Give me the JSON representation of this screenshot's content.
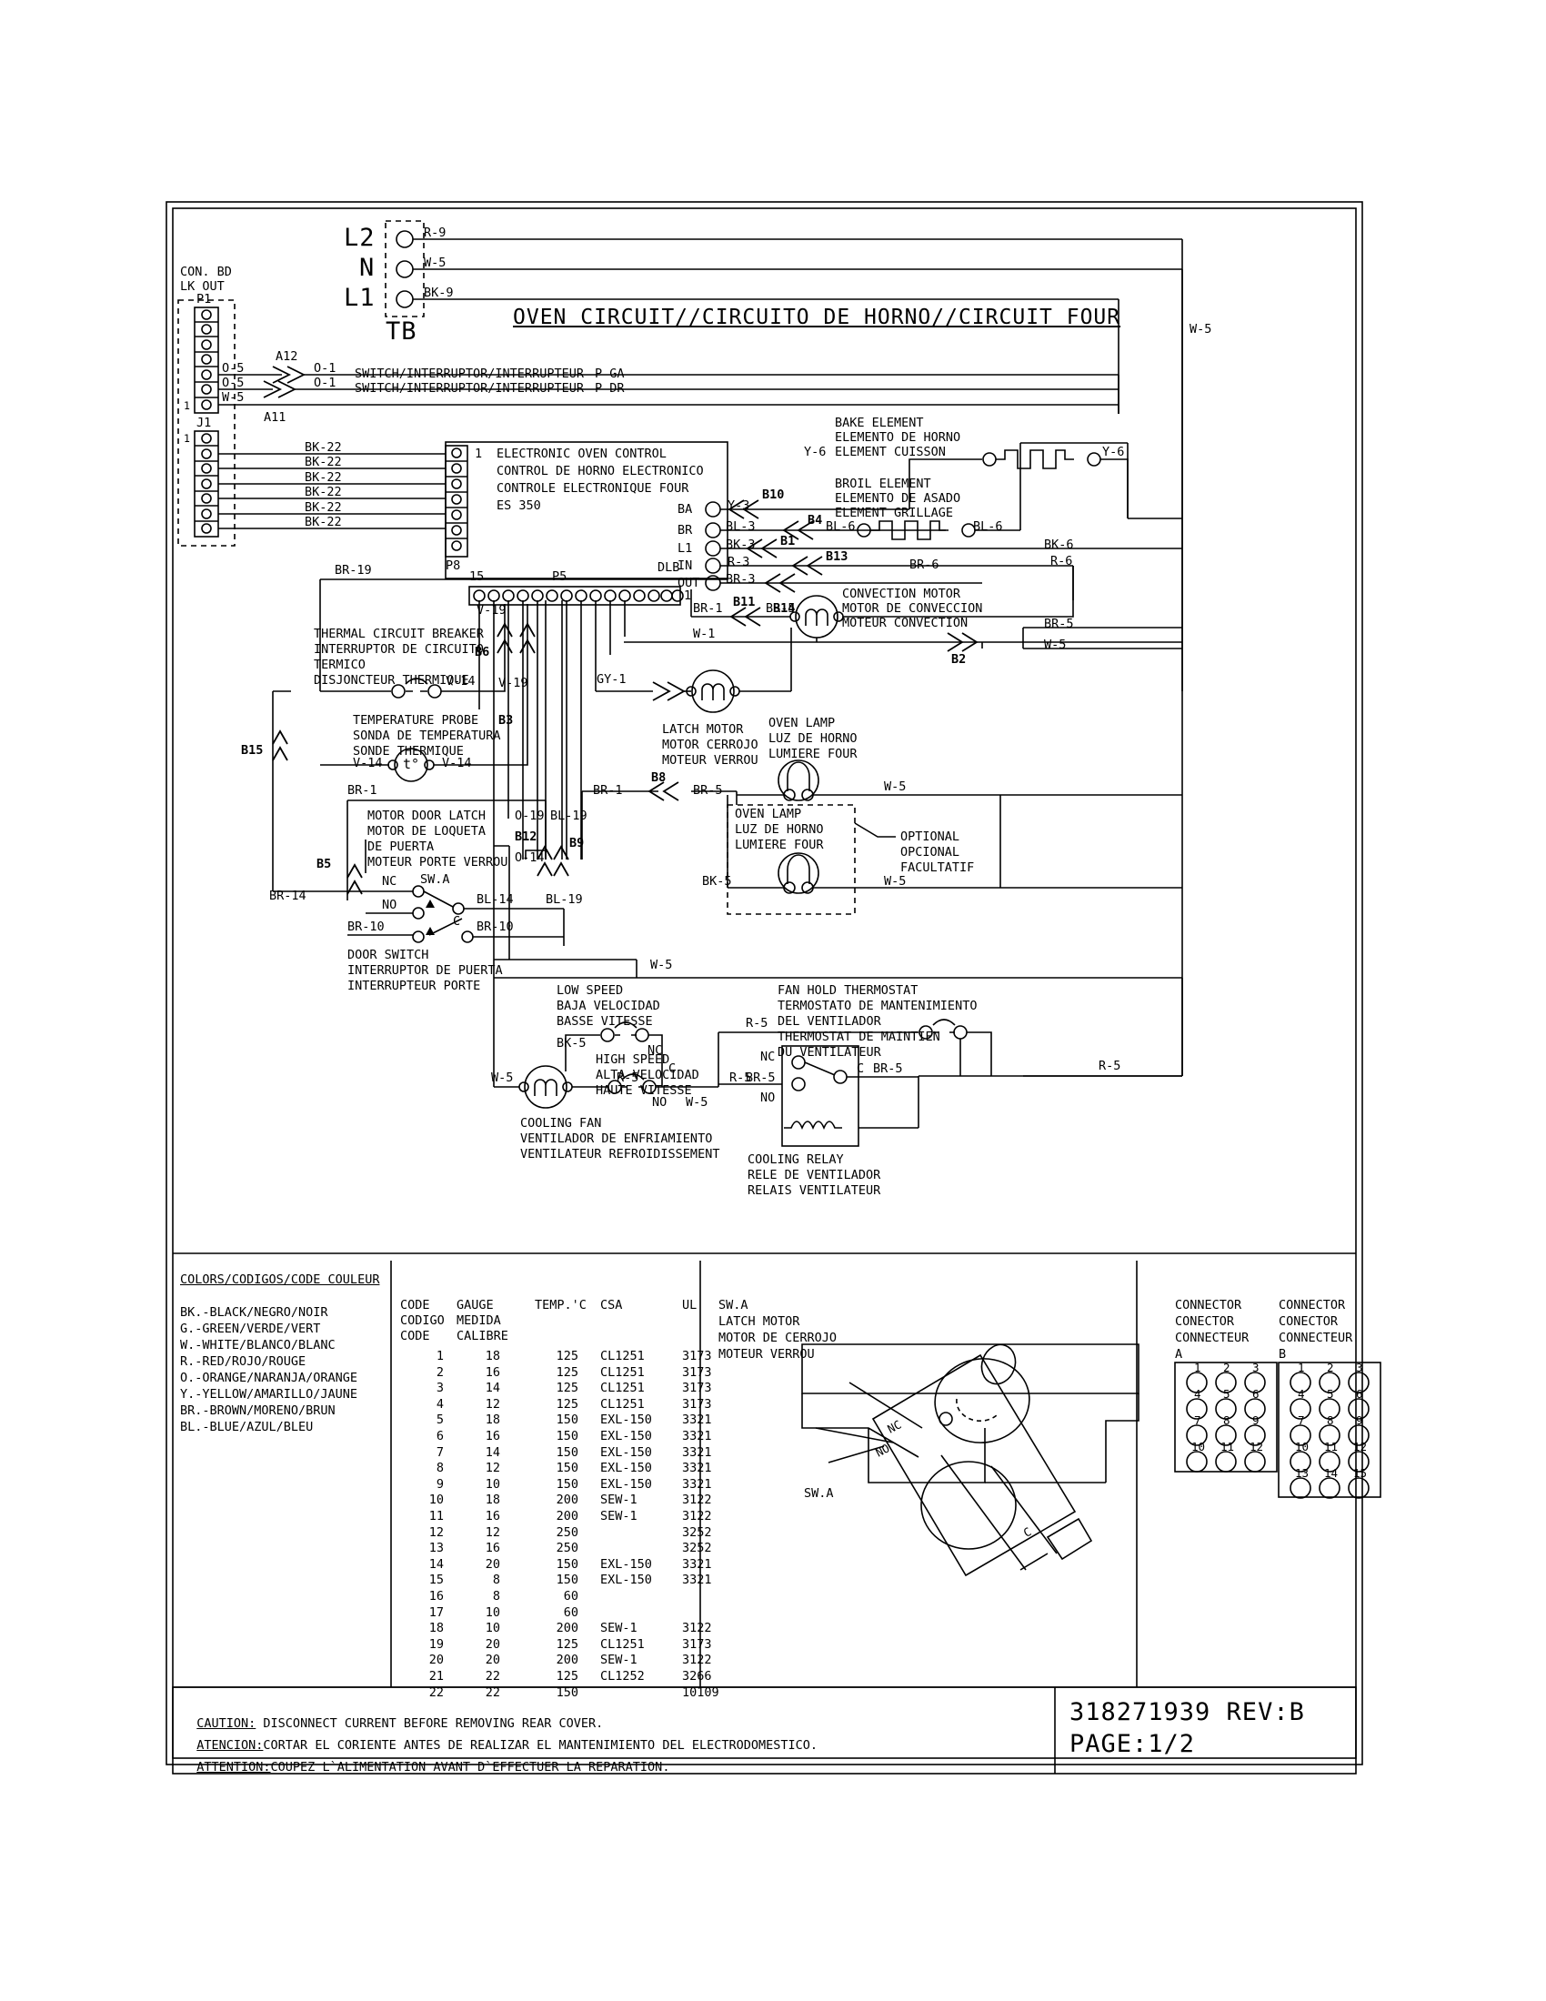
{
  "document": {
    "title": "OVEN CIRCUIT//CIRCUITO DE HORNO//CIRCUIT FOUR",
    "part_number": "318271939 REV:B",
    "page": "PAGE:1/2"
  },
  "terminal_block": {
    "name": "TB",
    "terminals": [
      {
        "label": "L2",
        "wire": "R-9"
      },
      {
        "label": "N",
        "wire": "W-5"
      },
      {
        "label": "L1",
        "wire": "BK-9"
      }
    ]
  },
  "connector_board": {
    "line1": "CON. BD",
    "line2": "LK OUT",
    "p1": "P1",
    "j1": "J1",
    "pin1": "1",
    "wires": [
      "O-5",
      "O-5",
      "W-5"
    ],
    "splices": [
      "A12",
      "A11"
    ],
    "switch_rows": [
      {
        "wire": "O-1",
        "text": "SWITCH/INTERRUPTOR/INTERRUPTEUR",
        "suffix": "P GA"
      },
      {
        "wire": "O-1",
        "text": "SWITCH/INTERRUPTOR/INTERRUPTEUR",
        "suffix": "P DR"
      }
    ],
    "bk22": [
      "BK-22",
      "BK-22",
      "BK-22",
      "BK-22",
      "BK-22",
      "BK-22"
    ]
  },
  "oven_control": {
    "lines": [
      "ELECTRONIC OVEN CONTROL",
      "CONTROL DE HORNO ELECTRONICO",
      "CONTROLE ELECTRONIQUE FOUR",
      "ES 350"
    ],
    "p8": "P8",
    "p8_pin1": "1",
    "p5": "P5",
    "p5_pin15": "15",
    "p5_pin1": "1",
    "dlb": "DLB",
    "terminals": [
      "BA",
      "BR",
      "L1",
      "IN",
      "OUT"
    ],
    "terminal_wires": [
      "Y-3",
      "BL-3",
      "BK-3",
      "R-3",
      "BR-3"
    ]
  },
  "bake_element": {
    "lines": [
      "BAKE ELEMENT",
      "ELEMENTO DE HORNO",
      "ELEMENT CUISSON"
    ],
    "wire_left": "Y-6",
    "wire_right": "Y-6"
  },
  "broil_element": {
    "lines": [
      "BROIL ELEMENT",
      "ELEMENTO DE ASADO",
      "ELEMENT GRILLAGE"
    ],
    "wire_left": "BL-6",
    "wire_right": "BL-6"
  },
  "convection_motor": {
    "lines": [
      "CONVECTION MOTOR",
      "MOTOR DE CONVECCION",
      "MOTEUR CONVECTION"
    ],
    "wire_in": "BR-1",
    "wire_mid": "BR-5",
    "wire_top": "BR-6"
  },
  "thermal_breaker": {
    "lines": [
      "THERMAL CIRCUIT BREAKER",
      "INTERRUPTOR DE CIRCUITO",
      "TERMICO",
      "DISJONCTEUR THERMIQUE"
    ],
    "ref": "B6",
    "wire_out": "V-14",
    "wire_up": "V-19"
  },
  "temperature_probe": {
    "lines": [
      "TEMPERATURE PROBE",
      "SONDA DE TEMPERATURA",
      "SONDE THERMIQUE"
    ],
    "ref": "B3",
    "wire_left": "V-14",
    "wire_right": "V-14",
    "wire_up": "V-19",
    "glyph": "t°"
  },
  "motor_door_latch": {
    "lines": [
      "MOTOR DOOR LATCH",
      "MOTOR DE LOQUETA",
      "DE PUERTA",
      "MOTEUR PORTE VERROU"
    ],
    "wire_top": "BR-1",
    "refs": [
      "B12",
      "B9",
      "B5"
    ],
    "wires_right": [
      "O-19",
      "O-14",
      "BL-19"
    ],
    "sw_a": "SW.A",
    "nc": "NC",
    "no": "NO",
    "c": "C",
    "wire_bl14": "BL-14",
    "wire_bl19": "BL-19",
    "wire_br14": "BR-14"
  },
  "door_switch": {
    "lines": [
      "DOOR SWITCH",
      "INTERRUPTOR DE PUERTA",
      "INTERRUPTEUR PORTE"
    ],
    "wire_left": "BR-10",
    "wire_right": "BR-10"
  },
  "latch_motor": {
    "lines": [
      "LATCH MOTOR",
      "MOTOR CERROJO",
      "MOTEUR VERROU"
    ],
    "wire_in": "GY-1",
    "wire_br1": "BR-1",
    "wire_br5": "BR-5",
    "ref": "B8"
  },
  "oven_lamp": {
    "lines": [
      "OVEN LAMP",
      "LUZ DE HORNO",
      "LUMIERE FOUR"
    ],
    "wire_right": "W-5"
  },
  "oven_lamp_optional": {
    "lines": [
      "OVEN LAMP",
      "LUZ DE HORNO",
      "LUMIERE FOUR"
    ],
    "note": [
      "OPTIONAL",
      "OPCIONAL",
      "FACULTATIF"
    ],
    "wire_left": "BK-5",
    "wire_right": "W-5"
  },
  "cooling_fan": {
    "lines": [
      "COOLING FAN",
      "VENTILADOR DE ENFRIAMIENTO",
      "VENTILATEUR REFROIDISSEMENT"
    ],
    "low_speed": [
      "LOW SPEED",
      "BAJA VELOCIDAD",
      "BASSE VITESSE"
    ],
    "high_speed": [
      "HIGH SPEED",
      "ALTA VELOCIDAD",
      "HAUTE VITESSE"
    ],
    "wire_w5_left": "W-5",
    "wire_bk5": "BK-5",
    "wire_r5": "R-5",
    "wire_w5_bottom": "W-5",
    "wire_r5_right": "R-5",
    "nc": "NC",
    "no": "NO",
    "c": "C"
  },
  "fan_hold_thermostat": {
    "lines": [
      "FAN HOLD THERMOSTAT",
      "TERMOSTATO DE MANTENIMIENTO",
      "DEL VENTILADOR",
      "THERMOSTAT DE MAINTIEN",
      "DU VENTILATEUR"
    ],
    "wire_r5": "R-5",
    "wire_br5_left": "BR-5",
    "wire_br5_right": "BR-5",
    "c": "C"
  },
  "cooling_relay": {
    "lines": [
      "COOLING RELAY",
      "RELE DE VENTILADOR",
      "RELAIS VENTILATEUR"
    ],
    "nc": "NC",
    "no": "NO"
  },
  "bus_labels": {
    "w5_top": "W-5",
    "bk6": "BK-6",
    "r6": "R-6",
    "br5": "BR-5",
    "w5_mid": "W-5",
    "b2": "B2",
    "w5_low": "W-5",
    "r5_right": "R-5",
    "w1": "W-1",
    "br19": "BR-19",
    "br1": "BR-1",
    "b15": "B15",
    "b11": "B11",
    "b14": "B14",
    "b10": "B10",
    "b4": "B4",
    "b1": "B1",
    "b13": "B13",
    "b8": "B8",
    "br1_lamp": "BR-1",
    "br5_lamp": "BR-5"
  },
  "legend_colors": {
    "title": "COLORS/CODIGOS/CODE COULEUR",
    "items": [
      "BK.-BLACK/NEGRO/NOIR",
      "G.-GREEN/VERDE/VERT",
      "W.-WHITE/BLANCO/BLANC",
      "R.-RED/ROJO/ROUGE",
      "O.-ORANGE/NARANJA/ORANGE",
      "Y.-YELLOW/AMARILLO/JAUNE",
      "BR.-BROWN/MORENO/BRUN",
      "BL.-BLUE/AZUL/BLEU"
    ]
  },
  "gauge_table": {
    "headers_row1": [
      "CODE",
      "GAUGE",
      "TEMP.'C",
      "CSA",
      "UL"
    ],
    "headers_row2": [
      "CODIGO",
      "MEDIDA",
      "",
      "",
      ""
    ],
    "headers_row3": [
      "CODE",
      "CALIBRE",
      "",
      "",
      ""
    ],
    "rows": [
      [
        "1",
        "18",
        "125",
        "CL1251",
        "3173"
      ],
      [
        "2",
        "16",
        "125",
        "CL1251",
        "3173"
      ],
      [
        "3",
        "14",
        "125",
        "CL1251",
        "3173"
      ],
      [
        "4",
        "12",
        "125",
        "CL1251",
        "3173"
      ],
      [
        "5",
        "18",
        "150",
        "EXL-150",
        "3321"
      ],
      [
        "6",
        "16",
        "150",
        "EXL-150",
        "3321"
      ],
      [
        "7",
        "14",
        "150",
        "EXL-150",
        "3321"
      ],
      [
        "8",
        "12",
        "150",
        "EXL-150",
        "3321"
      ],
      [
        "9",
        "10",
        "150",
        "EXL-150",
        "3321"
      ],
      [
        "10",
        "18",
        "200",
        "SEW-1",
        "3122"
      ],
      [
        "11",
        "16",
        "200",
        "SEW-1",
        "3122"
      ],
      [
        "12",
        "12",
        "250",
        "",
        "3252"
      ],
      [
        "13",
        "16",
        "250",
        "",
        "3252"
      ],
      [
        "14",
        "20",
        "150",
        "EXL-150",
        "3321"
      ],
      [
        "15",
        "8",
        "150",
        "EXL-150",
        "3321"
      ],
      [
        "16",
        "8",
        "60",
        "",
        ""
      ],
      [
        "17",
        "10",
        "60",
        "",
        ""
      ],
      [
        "18",
        "10",
        "200",
        "SEW-1",
        "3122"
      ],
      [
        "19",
        "20",
        "125",
        "CL1251",
        "3173"
      ],
      [
        "20",
        "20",
        "200",
        "SEW-1",
        "3122"
      ],
      [
        "21",
        "22",
        "125",
        "CL1252",
        "3266"
      ],
      [
        "22",
        "22",
        "150",
        "",
        "10109"
      ]
    ]
  },
  "sw_a_detail": {
    "lines": [
      "SW.A",
      "LATCH MOTOR",
      "MOTOR DE CERROJO",
      "MOTEUR VERROU"
    ],
    "nc": "NC",
    "no": "NO",
    "c": "C",
    "label": "SW.A"
  },
  "connector_a": {
    "lines": [
      "CONNECTOR",
      "CONECTOR",
      "CONNECTEUR"
    ],
    "id": "A",
    "pins": [
      "1",
      "2",
      "3",
      "4",
      "5",
      "6",
      "7",
      "8",
      "9",
      "10",
      "11",
      "12"
    ]
  },
  "connector_b": {
    "lines": [
      "CONNECTOR",
      "CONECTOR",
      "CONNECTEUR"
    ],
    "id": "B",
    "pins": [
      "1",
      "2",
      "3",
      "4",
      "5",
      "6",
      "7",
      "8",
      "9",
      "10",
      "11",
      "12",
      "13",
      "14",
      "15"
    ]
  },
  "caution": {
    "en_label": "CAUTION:",
    "en_text": " DISCONNECT CURRENT BEFORE REMOVING REAR COVER.",
    "es_label": "ATENCION:",
    "es_text": "CORTAR EL CORIENTE ANTES DE REALIZAR EL MANTENIMIENTO DEL ELECTRODOMESTICO.",
    "fr_label": "ATTENTION:",
    "fr_text": "COUPEZ L`ALIMENTATION AVANT D`EFFECTUER LA REPARATION."
  }
}
